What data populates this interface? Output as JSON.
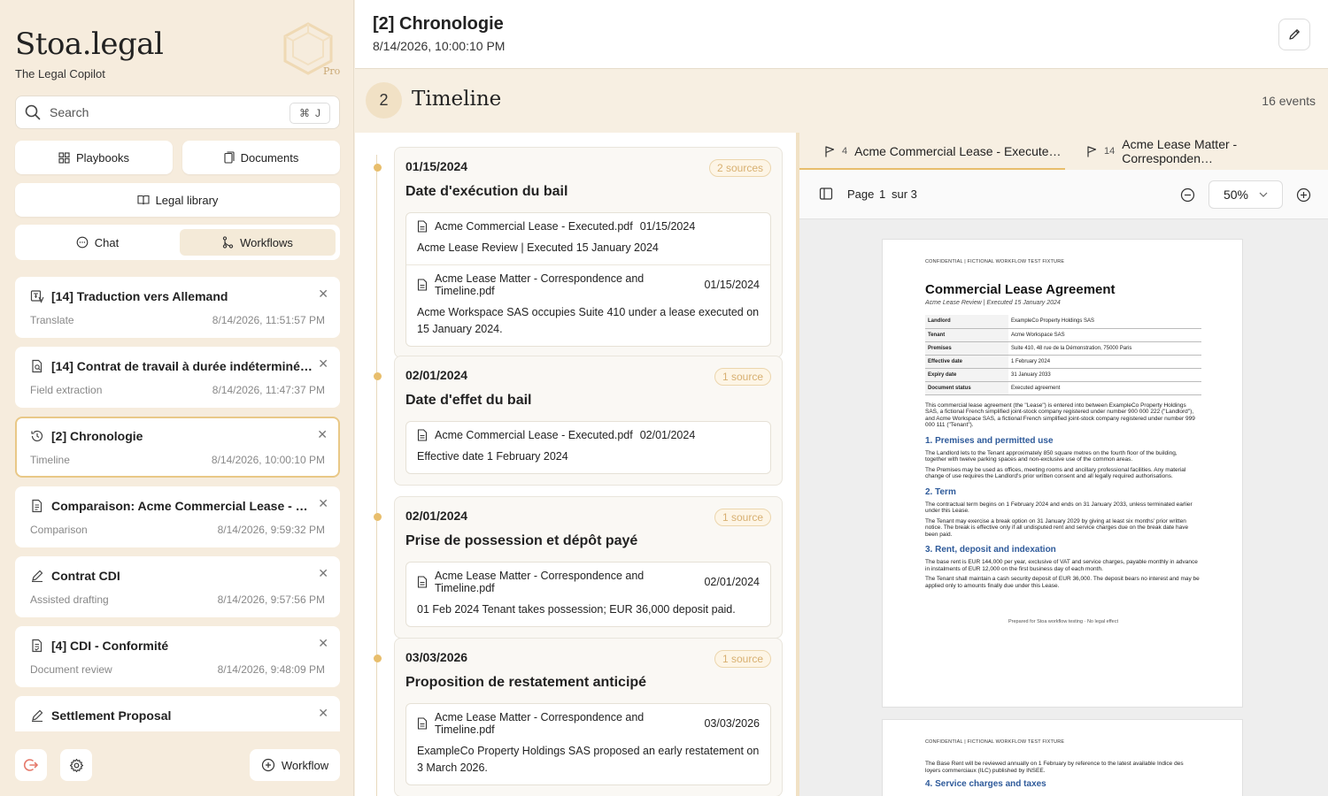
{
  "sidebar": {
    "brand": "Stoa.legal",
    "tagline": "The Legal Copilot",
    "pro_label": "Pro",
    "search": {
      "label": "Search",
      "shortcut_symbol": "⌘",
      "shortcut_key": "J"
    },
    "buttons": {
      "playbooks": "Playbooks",
      "documents": "Documents",
      "legal_library": "Legal library"
    },
    "tabs": {
      "chat": "Chat",
      "workflows": "Workflows",
      "active": "workflows"
    },
    "items": [
      {
        "title": "[14] Traduction vers Allemand",
        "type": "Translate",
        "timestamp": "8/14/2026, 11:51:57 PM",
        "icon": "translate-icon"
      },
      {
        "title": "[14] Contrat de travail à durée indéterminé…",
        "type": "Field extraction",
        "timestamp": "8/14/2026, 11:47:37 PM",
        "icon": "document-search-icon"
      },
      {
        "title": "[2] Chronologie",
        "type": "Timeline",
        "timestamp": "8/14/2026, 10:00:10 PM",
        "icon": "history-icon",
        "selected": true
      },
      {
        "title": "Comparaison: Acme Commercial Lease - …",
        "type": "Comparison",
        "timestamp": "8/14/2026, 9:59:32 PM",
        "icon": "document-compare-icon"
      },
      {
        "title": "Contrat CDI",
        "type": "Assisted drafting",
        "timestamp": "8/14/2026, 9:57:56 PM",
        "icon": "pen-icon"
      },
      {
        "title": "[4] CDI - Conformité",
        "type": "Document review",
        "timestamp": "8/14/2026, 9:48:09 PM",
        "icon": "document-check-icon"
      },
      {
        "title": "Settlement Proposal",
        "type": "",
        "timestamp": "",
        "icon": "pen-icon"
      }
    ],
    "workflow_button": "Workflow"
  },
  "header": {
    "title": "[2] Chronologie",
    "date": "8/14/2026, 10:00:10 PM"
  },
  "section": {
    "step": "2",
    "title": "Timeline",
    "events": "16 events"
  },
  "timeline": [
    {
      "date": "01/15/2024",
      "badge": "2 sources",
      "title": "Date d'exécution du bail",
      "sources": [
        {
          "file": "Acme Commercial Lease - Executed.pdf",
          "date": "01/15/2024",
          "text": "Acme Lease Review | Executed 15 January 2024"
        },
        {
          "file": "Acme Lease Matter - Correspondence and Timeline.pdf",
          "date": "01/15/2024",
          "text": "Acme Workspace SAS occupies Suite 410 under a lease executed on 15 January 2024."
        }
      ]
    },
    {
      "date": "02/01/2024",
      "badge": "1 source",
      "title": "Date d'effet du bail",
      "sources": [
        {
          "file": "Acme Commercial Lease - Executed.pdf",
          "date": "02/01/2024",
          "text": "Effective date 1 February 2024"
        }
      ]
    },
    {
      "date": "02/01/2024",
      "badge": "1 source",
      "title": "Prise de possession et dépôt payé",
      "sources": [
        {
          "file": "Acme Lease Matter - Correspondence and Timeline.pdf",
          "date": "02/01/2024",
          "text": "01 Feb 2024 Tenant takes possession; EUR 36,000 deposit paid."
        }
      ]
    },
    {
      "date": "03/03/2026",
      "badge": "1 source",
      "title": "Proposition de restatement anticipé",
      "sources": [
        {
          "file": "Acme Lease Matter - Correspondence and Timeline.pdf",
          "date": "03/03/2026",
          "text": "ExampleCo Property Holdings SAS proposed an early restatement on 3 March 2026."
        }
      ]
    }
  ],
  "viewer": {
    "tabs": [
      {
        "count": "4",
        "label": "Acme Commercial Lease - Execute…"
      },
      {
        "count": "14",
        "label": "Acme Lease Matter - Corresponden…"
      }
    ],
    "page_label": "Page",
    "page_current": "1",
    "page_of": "sur 3",
    "zoom": "50%",
    "page1": {
      "confidential": "CONFIDENTIAL  |  FICTIONAL WORKFLOW TEST FIXTURE",
      "title": "Commercial Lease Agreement",
      "subtitle": "Acme Lease Review | Executed 15 January 2024",
      "table": [
        {
          "k": "Landlord",
          "v": "ExampleCo Property Holdings SAS"
        },
        {
          "k": "Tenant",
          "v": "Acme Workspace SAS"
        },
        {
          "k": "Premises",
          "v": "Suite 410, 48 rue de la Démonstration, 75000 Paris"
        },
        {
          "k": "Effective date",
          "v": "1 February 2024"
        },
        {
          "k": "Expiry date",
          "v": "31 January 2033"
        },
        {
          "k": "Document status",
          "v": "Executed agreement"
        }
      ],
      "intro": "This commercial lease agreement (the \"Lease\") is entered into between ExampleCo Property Holdings SAS, a fictional French simplified joint-stock company registered under number 900 000 222 (\"Landlord\"), and Acme Workspace SAS, a fictional French simplified joint-stock company registered under number 999 000 111 (\"Tenant\").",
      "h1": "1. Premises and permitted use",
      "p1a": "The Landlord lets to the Tenant approximately 850 square metres on the fourth floor of the building, together with twelve parking spaces and non-exclusive use of the common areas.",
      "p1b": "The Premises may be used as offices, meeting rooms and ancillary professional facilities. Any material change of use requires the Landlord's prior written consent and all legally required authorisations.",
      "h2": "2. Term",
      "p2a": "The contractual term begins on 1 February 2024 and ends on 31 January 2033, unless terminated earlier under this Lease.",
      "p2b": "The Tenant may exercise a break option on 31 January 2029 by giving at least six months' prior written notice. The break is effective only if all undisputed rent and service charges due on the break date have been paid.",
      "h3": "3. Rent, deposit and indexation",
      "p3a": "The base rent is EUR 144,000 per year, exclusive of VAT and service charges, payable monthly in advance in instalments of EUR 12,000 on the first business day of each month.",
      "p3b": "The Tenant shall maintain a cash security deposit of EUR 36,000. The deposit bears no interest and may be applied only to amounts finally due under this Lease.",
      "footer": "Prepared for Stoa workflow testing · No legal effect"
    },
    "page2": {
      "confidential": "CONFIDENTIAL  |  FICTIONAL WORKFLOW TEST FIXTURE",
      "p1": "The Base Rent will be reviewed annually on 1 February by reference to the latest available Indice des loyers commerciaux (ILC) published by INSEE.",
      "h4": "4. Service charges and taxes"
    }
  },
  "colors": {
    "accent": "#e8be6c",
    "sidebar_bg": "#f6ecdd",
    "link_blue": "#2e5a9a"
  }
}
